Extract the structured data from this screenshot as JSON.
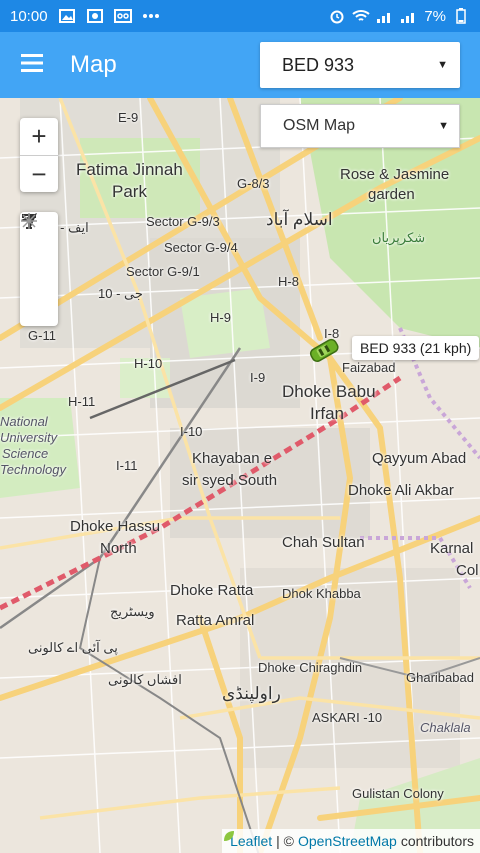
{
  "status_bar": {
    "time": "10:00",
    "battery": "7%"
  },
  "app_bar": {
    "title": "Map",
    "vehicle_select": "BED 933"
  },
  "map": {
    "layer_select": "OSM Map",
    "zoom_in": "+",
    "zoom_out": "−",
    "labels": [
      "E-9",
      "Fatima Jinnah",
      "Park",
      "G-8/3",
      "Rose & Jasmine",
      "garden",
      "Sector G-9/3",
      "اسلام آباد",
      "شکرپریاں",
      "Sector G-9/4",
      "Sector G-9/1",
      "H-8",
      "H-9",
      "G-11",
      "I-8",
      "H-10",
      "I-9",
      "Faizabad",
      "H-11",
      "Dhoke Babu",
      "Irfan",
      "I-10",
      "National",
      "University",
      "Science",
      "Technology",
      "Qayyum Abad",
      "Khayaban e",
      "sir syed South",
      "I-11",
      "Dhoke Ali Akbar",
      "Dhoke Hassu",
      "North",
      "Chah Sultan",
      "Karnal",
      "Dhoke Ratta",
      "Dhok Khabba",
      "Ratta Amral",
      "Dhoke Chiraghdin",
      "راولپنڈی",
      "Gharibabad",
      "ASKARI -10",
      "Chaklala",
      "Gulistan Colony",
      "ایف - 10",
      "جی - 10",
      "ویسٹریج",
      "پی آئی اے کالونی",
      "افشاں کالونی",
      "Col"
    ],
    "vehicle_tooltip": "BED 933 (21 kph)",
    "attribution": {
      "leaflet": "Leaflet",
      "separator": "| ©",
      "osm": "OpenStreetMap",
      "suffix": "contributors"
    }
  },
  "colors": {
    "status_bar": "#1e88e5",
    "app_bar": "#42a5f5",
    "map_bg": "#ece6dd",
    "main_road": "#f7d27b",
    "park": "#c8e6b0",
    "rail": "#e05a6a"
  }
}
